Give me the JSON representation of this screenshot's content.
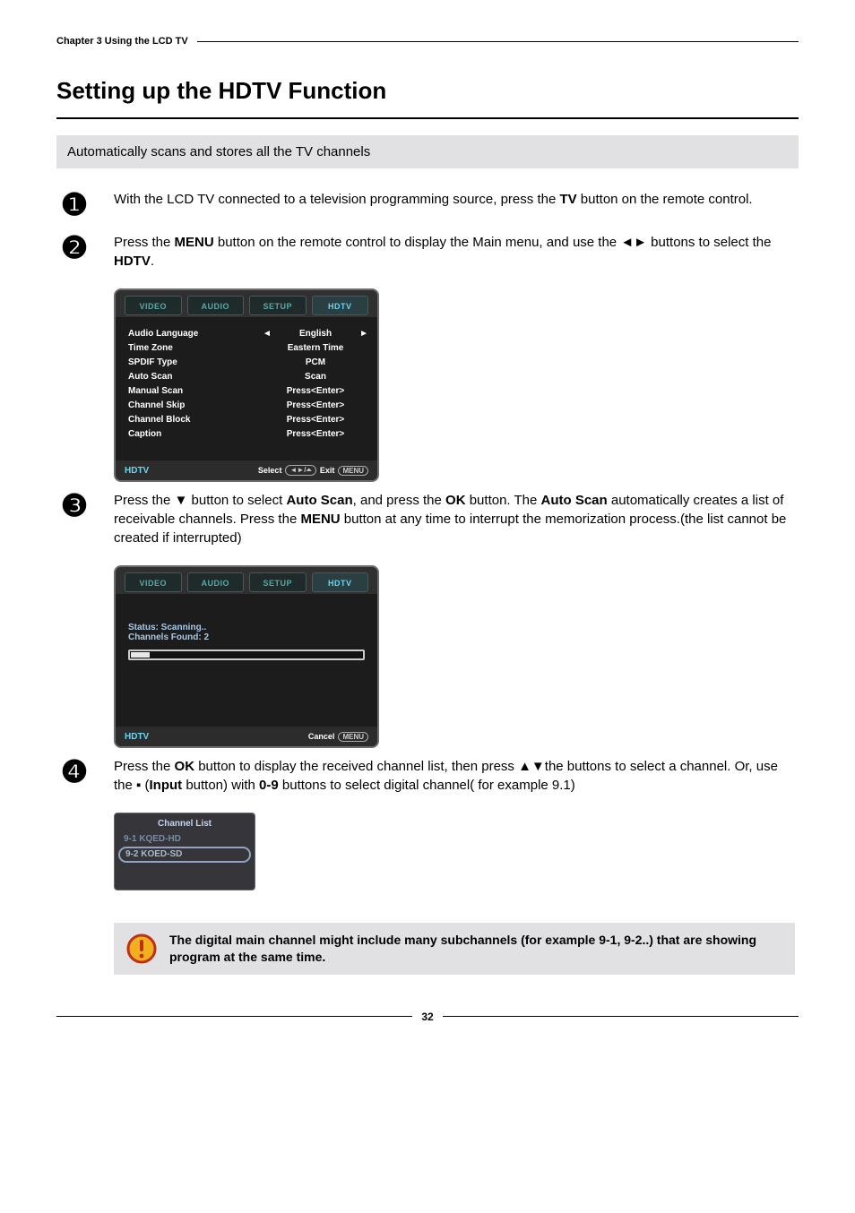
{
  "chapter_label": "Chapter 3 Using the LCD TV",
  "page_title": "Setting up the HDTV Function",
  "intro_box": "Automatically scans and stores all the TV channels",
  "steps": {
    "s1": {
      "bullet": "❶",
      "p1a": "With the LCD TV connected to a television programming source, press the ",
      "p1b_bold": "TV",
      "p1c": " button on the remote control."
    },
    "s2": {
      "bullet": "❷",
      "p1a": "Press the ",
      "p1b_bold": "MENU",
      "p1c": " button on the remote control to display the Main menu, and use the ◄► buttons to select the ",
      "p1d_bold": "HDTV",
      "p1e": "."
    },
    "s3": {
      "bullet": "❸",
      "p1a": "Press the ▼ button to select ",
      "p1b_bold": "Auto Scan",
      "p1c": ", and press the ",
      "p1d_bold": "OK",
      "p1e": " button. The ",
      "p1f_bold": "Auto Scan",
      "p1g": " automatically creates a list of receivable channels. Press the ",
      "p1h_bold": "MENU",
      "p1i": " button at any time to interrupt the memorization process.(the list cannot be created if interrupted)"
    },
    "s4": {
      "bullet": "❹",
      "p1a": "Press the ",
      "p1b_bold": "OK",
      "p1c": " button to display the received channel list, then press ▲▼the buttons to select a channel. Or, use the ▪ (",
      "p1d_bold": "Input",
      "p1e": " button) with ",
      "p1f_bold": "0-9",
      "p1g": " buttons to select digital channel( for example 9.1)"
    }
  },
  "osd1": {
    "tabs": [
      "VIDEO",
      "AUDIO",
      "SETUP",
      "HDTV"
    ],
    "active_tab_index": 3,
    "rows": [
      {
        "label": "Audio Language",
        "value": "English",
        "arrows": true
      },
      {
        "label": "Time Zone",
        "value": "Eastern Time",
        "arrows": false
      },
      {
        "label": "SPDIF Type",
        "value": "PCM",
        "arrows": false
      },
      {
        "label": "Auto Scan",
        "value": "Scan",
        "arrows": false
      },
      {
        "label": "Manual Scan",
        "value": "Press<Enter>",
        "arrows": false
      },
      {
        "label": "Channel Skip",
        "value": "Press<Enter>",
        "arrows": false
      },
      {
        "label": "Channel Block",
        "value": "Press<Enter>",
        "arrows": false
      },
      {
        "label": "Caption",
        "value": "Press<Enter>",
        "arrows": false
      }
    ],
    "footer": {
      "corner": "HDTV",
      "hint_select": "Select",
      "hint_btn1": "◄►/⏶",
      "hint_exit": "Exit",
      "hint_btn2": "MENU"
    }
  },
  "osd2": {
    "tabs": [
      "VIDEO",
      "AUDIO",
      "SETUP",
      "HDTV"
    ],
    "active_tab_index": 3,
    "status": "Status: Scanning..",
    "found": "Channels Found: 2",
    "footer": {
      "corner": "HDTV",
      "hint_cancel": "Cancel",
      "hint_btn": "MENU"
    }
  },
  "channel_list": {
    "title": "Channel List",
    "items": [
      "9-1 KQED-HD",
      "9-2 KOED-SD"
    ],
    "selected_index": 1
  },
  "note": {
    "text": "The digital main channel might include many subchannels (for example 9-1, 9-2..) that are showing program at the same time."
  },
  "page_number": "32"
}
